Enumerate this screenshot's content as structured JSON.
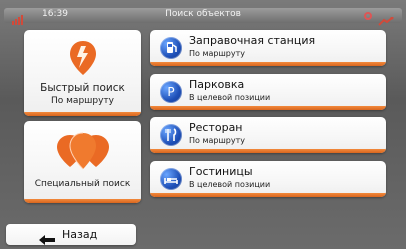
{
  "status": {
    "time": "16:39",
    "title": "Поиск объектов",
    "icons": [
      "signal-icon",
      "gps-icon",
      "satellite-icon"
    ]
  },
  "left_buttons": [
    {
      "label": "Быстрый поиск",
      "sub": "По маршруту",
      "icon": "lightning-pin-icon"
    },
    {
      "label": "Специальный поиск",
      "icon": "multi-pin-icon"
    }
  ],
  "categories": [
    {
      "title": "Заправочная станция",
      "sub": "По маршруту",
      "icon": "fuel-station-icon"
    },
    {
      "title": "Парковка",
      "sub": "В целевой позиции",
      "icon": "parking-icon"
    },
    {
      "title": "Ресторан",
      "sub": "По маршруту",
      "icon": "restaurant-icon"
    },
    {
      "title": "Гостиницы",
      "sub": "В целевой позиции",
      "icon": "hotel-icon"
    }
  ],
  "footer": {
    "back_label": "Назад",
    "back_icon": "back-arrow-icon"
  },
  "colors": {
    "accent": "#e8772a",
    "icon_blue": "#1e4fb7",
    "statusbar": "#7d7d7d"
  }
}
